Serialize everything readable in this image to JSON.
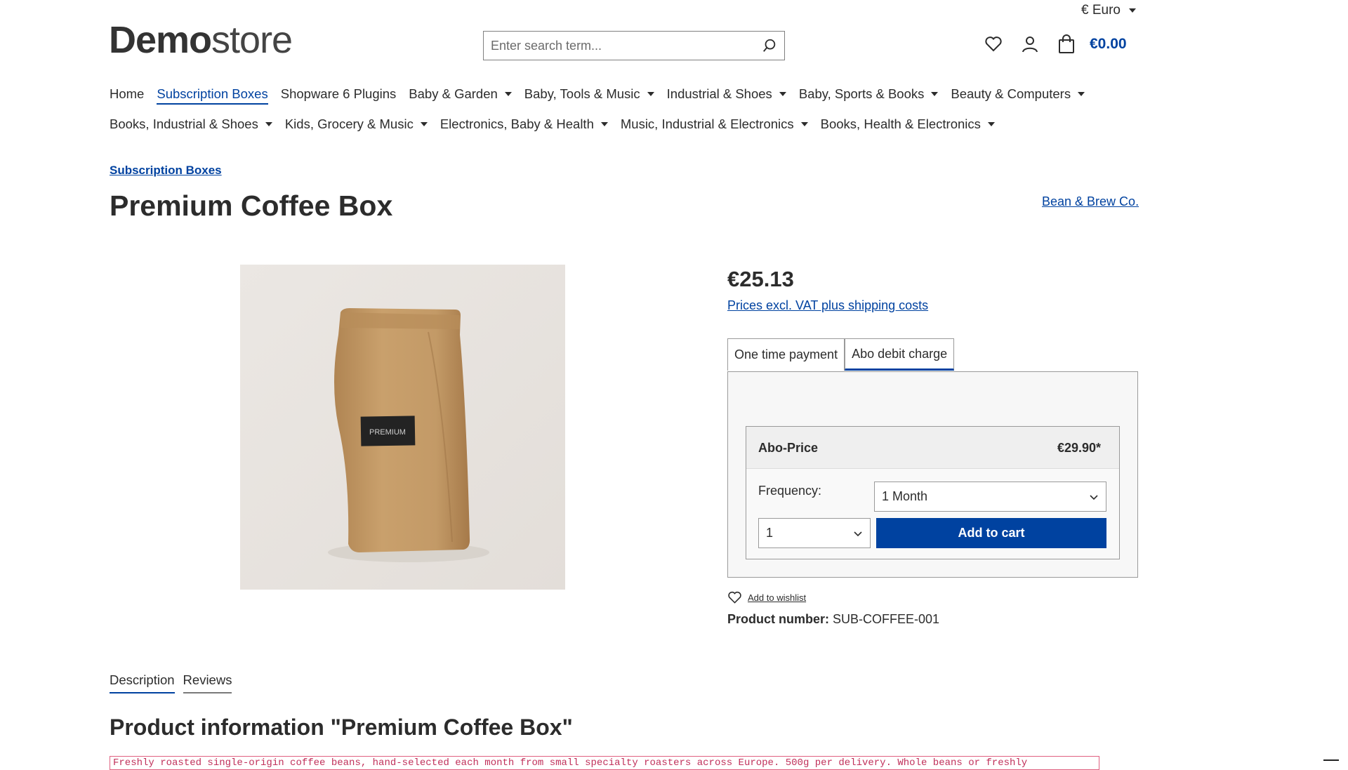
{
  "header": {
    "currency": "€ Euro",
    "logo_bold": "Demo",
    "logo_light": "store",
    "search_placeholder": "Enter search term...",
    "cart_total": "€0.00",
    "icons": [
      "search-icon",
      "heart-icon",
      "user-icon",
      "cart-bag-icon"
    ]
  },
  "nav": {
    "row1": [
      {
        "label": "Home",
        "dropdown": false,
        "active": false
      },
      {
        "label": "Subscription Boxes",
        "dropdown": false,
        "active": true
      },
      {
        "label": "Shopware 6 Plugins",
        "dropdown": false,
        "active": false
      },
      {
        "label": "Baby & Garden",
        "dropdown": true,
        "active": false
      },
      {
        "label": "Baby, Tools & Music",
        "dropdown": true,
        "active": false
      },
      {
        "label": "Industrial & Shoes",
        "dropdown": true,
        "active": false
      },
      {
        "label": "Baby, Sports & Books",
        "dropdown": true,
        "active": false
      },
      {
        "label": "Beauty & Computers",
        "dropdown": true,
        "active": false
      }
    ],
    "row2": [
      {
        "label": "Books, Industrial & Shoes",
        "dropdown": true
      },
      {
        "label": "Kids, Grocery & Music",
        "dropdown": true
      },
      {
        "label": "Electronics, Baby & Health",
        "dropdown": true
      },
      {
        "label": "Music, Industrial & Electronics",
        "dropdown": true
      },
      {
        "label": "Books, Health & Electronics",
        "dropdown": true
      }
    ]
  },
  "product": {
    "breadcrumb": "Subscription Boxes",
    "title": "Premium Coffee Box",
    "manufacturer": "Bean & Brew Co.",
    "image_label": "PREMIUM",
    "price": "€25.13",
    "vat_note": "Prices excl. VAT plus shipping costs",
    "tabs": [
      "One time payment",
      "Abo debit charge"
    ],
    "active_tab": 1,
    "abo_label": "Abo-Price",
    "abo_price": "€29.90*",
    "frequency_label": "Frequency:",
    "frequency_value": "1 Month",
    "quantity_value": "1",
    "add_to_cart": "Add to cart",
    "wishlist": "Add to wishlist",
    "product_number_label": "Product number:",
    "product_number": "SUB-COFFEE-001"
  },
  "details": {
    "tabs": [
      "Description",
      "Reviews"
    ],
    "info_title": "Product information \"Premium Coffee Box\"",
    "description": "Freshly roasted single-origin coffee beans, hand-selected each month from small specialty roasters across Europe. 500g per delivery. Whole beans or freshly"
  },
  "colors": {
    "accent": "#0042a0",
    "text": "#2c2c2c",
    "panel_bg": "#f7f7f7"
  }
}
